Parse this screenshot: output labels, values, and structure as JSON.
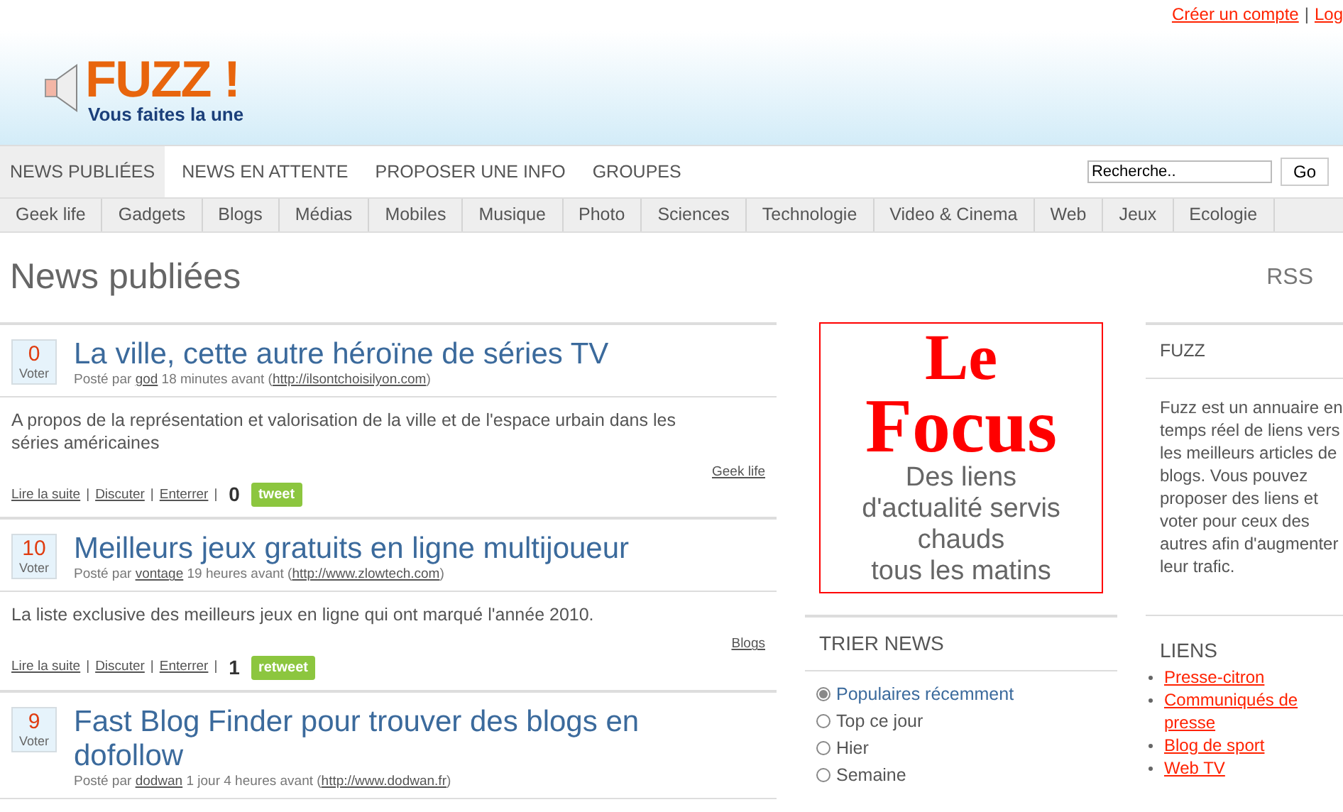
{
  "top_links": {
    "items": [
      "Créer un compte",
      "Log"
    ],
    "separator": "|"
  },
  "logo": {
    "title": "FUZZ !",
    "tagline": "Vous faites la une"
  },
  "nav": {
    "tabs": [
      {
        "label": "NEWS PUBLIÉES",
        "selected": true
      },
      {
        "label": "NEWS EN ATTENTE",
        "selected": false
      },
      {
        "label": "PROPOSER UNE INFO",
        "selected": false
      },
      {
        "label": "GROUPES",
        "selected": false
      }
    ],
    "search": {
      "value": "Recherche..",
      "button": "Go"
    }
  },
  "categories": [
    "Geek life",
    "Gadgets",
    "Blogs",
    "Médias",
    "Mobiles",
    "Musique",
    "Photo",
    "Sciences",
    "Technologie",
    "Video & Cinema",
    "Web",
    "Jeux",
    "Ecologie"
  ],
  "page_title": "News publiées",
  "rss": "RSS",
  "posts": [
    {
      "votes": "0",
      "vote_label": "Voter",
      "title": "La ville, cette autre héroïne de séries TV",
      "byline": [
        {
          "text": "Posté par ",
          "link": false
        },
        {
          "text": "god",
          "link": true
        },
        {
          "text": " 18 minutes avant (",
          "link": false
        },
        {
          "text": "http://ilsontchoisilyon.com",
          "link": true
        },
        {
          "text": ")",
          "link": false
        }
      ],
      "description": "A propos de la représentation et valorisation de la ville et de l'espace urbain dans les séries américaines",
      "category": "Geek life",
      "actions": [
        "Lire la suite",
        "Discuter",
        "Enterrer"
      ],
      "count": "0",
      "share": "tweet"
    },
    {
      "votes": "10",
      "vote_label": "Voter",
      "title": "Meilleurs jeux gratuits en ligne multijoueur",
      "byline": [
        {
          "text": "Posté par ",
          "link": false
        },
        {
          "text": "vontage",
          "link": true
        },
        {
          "text": " 19 heures avant (",
          "link": false
        },
        {
          "text": "http://www.zlowtech.com",
          "link": true
        },
        {
          "text": ")",
          "link": false
        }
      ],
      "description": "La liste exclusive des meilleurs jeux en ligne qui ont marqué l'année 2010.",
      "category": "Blogs",
      "actions": [
        "Lire la suite",
        "Discuter",
        "Enterrer"
      ],
      "count": "1",
      "share": "retweet"
    },
    {
      "votes": "9",
      "vote_label": "Voter",
      "title": "Fast Blog Finder pour trouver des blogs en dofollow",
      "byline": [
        {
          "text": "Posté par ",
          "link": false
        },
        {
          "text": "dodwan",
          "link": true
        },
        {
          "text": " 1 jour 4 heures avant (",
          "link": false
        },
        {
          "text": "http://www.dodwan.fr",
          "link": true
        },
        {
          "text": ")",
          "link": false
        }
      ]
    }
  ],
  "action_separator": "|",
  "ad": {
    "title_1": "Le",
    "title_2": "Focus",
    "text": [
      "Des liens",
      "d'actualité servis",
      "chauds",
      "tous les matins"
    ]
  },
  "sort": {
    "title": "TRIER NEWS",
    "options": [
      {
        "label": "Populaires récemment",
        "selected": true
      },
      {
        "label": "Top ce jour",
        "selected": false
      },
      {
        "label": "Hier",
        "selected": false
      },
      {
        "label": "Semaine",
        "selected": false
      }
    ]
  },
  "about": {
    "title": "FUZZ",
    "text": "Fuzz est un annuaire en temps réel de liens vers les meilleurs articles de blogs. Vous pouvez proposer des liens et voter pour ceux des autres afin d'augmenter leur trafic."
  },
  "links": {
    "title": "LIENS",
    "items": [
      "Presse-citron",
      "Communiqués de presse",
      "Blog de sport",
      "Web TV"
    ]
  }
}
